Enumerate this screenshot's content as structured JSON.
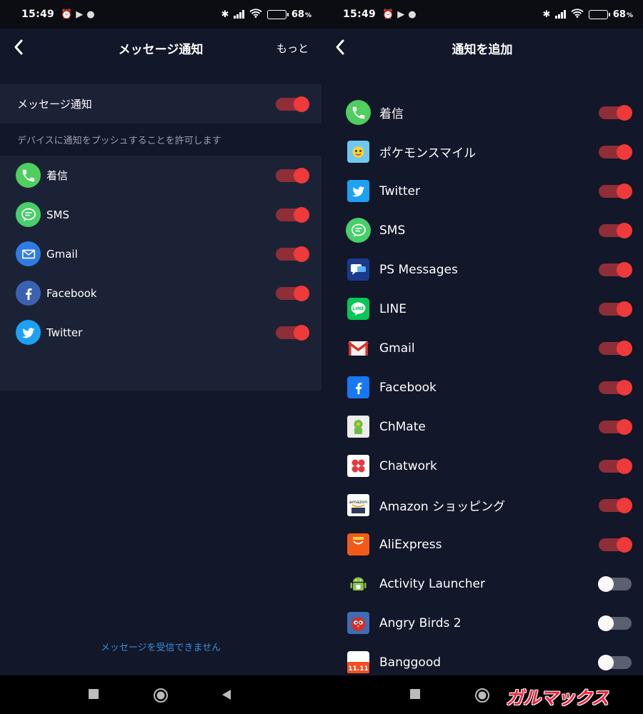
{
  "statusbar": {
    "time": "15:49",
    "battery_pct": "68",
    "pct_unit": "%",
    "battery_level": 0.68
  },
  "left": {
    "title": "メッセージ通知",
    "more_label": "もっと",
    "master_label": "メッセージ通知",
    "master_enabled": true,
    "description": "デバイスに通知をプッシュすることを許可します",
    "apps": [
      {
        "name": "着信",
        "icon": "phone-icon",
        "enabled": true
      },
      {
        "name": "SMS",
        "icon": "sms-icon",
        "enabled": true
      },
      {
        "name": "Gmail",
        "icon": "mail-icon",
        "enabled": true
      },
      {
        "name": "Facebook",
        "icon": "facebook-icon",
        "enabled": true
      },
      {
        "name": "Twitter",
        "icon": "twitter-icon",
        "enabled": true
      }
    ],
    "footer_message": "メッセージを受信できません"
  },
  "right": {
    "title": "通知を追加",
    "apps": [
      {
        "name": "着信",
        "icon": "phone-icon",
        "enabled": true
      },
      {
        "name": "ポケモンスマイル",
        "icon": "pokemon-smile-icon",
        "enabled": true
      },
      {
        "name": "Twitter",
        "icon": "twitter-icon",
        "enabled": true
      },
      {
        "name": "SMS",
        "icon": "sms-icon",
        "enabled": true
      },
      {
        "name": "PS Messages",
        "icon": "ps-messages-icon",
        "enabled": true
      },
      {
        "name": "LINE",
        "icon": "line-icon",
        "enabled": true
      },
      {
        "name": "Gmail",
        "icon": "gmail-icon",
        "enabled": true
      },
      {
        "name": "Facebook",
        "icon": "facebook-icon",
        "enabled": true
      },
      {
        "name": "ChMate",
        "icon": "chmate-icon",
        "enabled": true
      },
      {
        "name": "Chatwork",
        "icon": "chatwork-icon",
        "enabled": true
      },
      {
        "name": "Amazon ショッピング",
        "icon": "amazon-icon",
        "enabled": true
      },
      {
        "name": "AliExpress",
        "icon": "aliexpress-icon",
        "enabled": true
      },
      {
        "name": "Activity Launcher",
        "icon": "android-icon",
        "enabled": false
      },
      {
        "name": "Angry Birds 2",
        "icon": "angry-birds-icon",
        "enabled": false
      },
      {
        "name": "Banggood",
        "icon": "banggood-icon",
        "enabled": false
      }
    ]
  },
  "watermark": "ガルマックス",
  "colors": {
    "background": "#121729",
    "panel": "#1c2235",
    "toggle_on_track": "#8f2e37",
    "toggle_on_knob": "#ee3a3a",
    "toggle_off_track": "#5b6070",
    "link": "#3b8ed8"
  }
}
